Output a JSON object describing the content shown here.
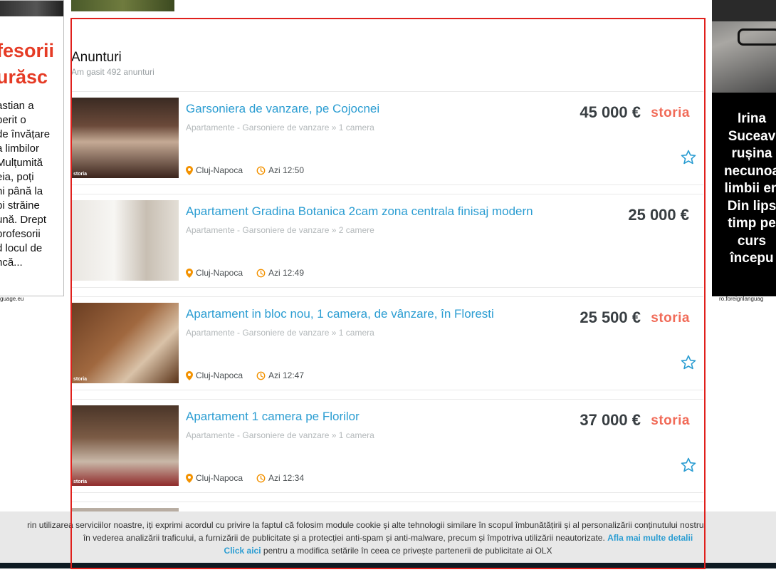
{
  "left_ad": {
    "headline": "fesorii\nurăsc",
    "body": "astian a\nperit o\nde învățare\na limbilor\nMulțumită\neia, poți\nni până la\npi străine\nună. Drept\nprofesorii\nd locul de\nncă...",
    "url": "guage.eu"
  },
  "right_ad": {
    "text": "Irina\nSuceav\nrușina\nnecunoa\nlimbii en\nDin lips\ntimp pe\ncurs\nîncepu",
    "url": "ro.foreignlanguag"
  },
  "listing": {
    "title": "Anunturi",
    "count_text": "Am gasit 492 anunturi",
    "offers": [
      {
        "title": "Garsoniera de vanzare, pe Cojocnei",
        "category": "Apartamente - Garsoniere de vanzare » 1 camera",
        "price": "45 000 €",
        "partner": "storia",
        "location": "Cluj-Napoca",
        "time": "Azi 12:50",
        "thumb_tag": "storia"
      },
      {
        "title": "Apartament Gradina Botanica 2cam zona centrala finisaj modern",
        "category": "Apartamente - Garsoniere de vanzare » 2 camere",
        "price": "25 000 €",
        "partner": "",
        "location": "Cluj-Napoca",
        "time": "Azi 12:49",
        "thumb_tag": ""
      },
      {
        "title": "Apartament in bloc nou, 1 camera, de vânzare, în Floresti",
        "category": "Apartamente - Garsoniere de vanzare » 1 camera",
        "price": "25 500 €",
        "partner": "storia",
        "location": "Cluj-Napoca",
        "time": "Azi 12:47",
        "thumb_tag": "storia"
      },
      {
        "title": "Apartament 1 camera pe Florilor",
        "category": "Apartamente - Garsoniere de vanzare » 1 camera",
        "price": "37 000 €",
        "partner": "storia",
        "location": "Cluj-Napoca",
        "time": "Azi 12:34",
        "thumb_tag": "storia"
      }
    ]
  },
  "cookie": {
    "line1": "rin utilizarea serviciilor noastre, iți exprimi acordul cu privire la faptul că folosim module cookie și alte tehnologii similare în scopul îmbunătățirii și al personalizării conținutului nostru,",
    "line2": "în vederea analizării traficului, a furnizării de publicitate și a protecției anti-spam și anti-malware, precum și împotriva utilizării neautorizate.",
    "link1": "Afla mai multe detalii",
    "link2": "Click aici",
    "line3": "pentru a modifica setările în ceea ce privește partenerii de publicitate ai OLX"
  },
  "colors": {
    "link": "#2b9dd2",
    "price": "#383e42",
    "storia": "#f16b58",
    "highlight": "#e0201c",
    "pin": "#f39200"
  }
}
